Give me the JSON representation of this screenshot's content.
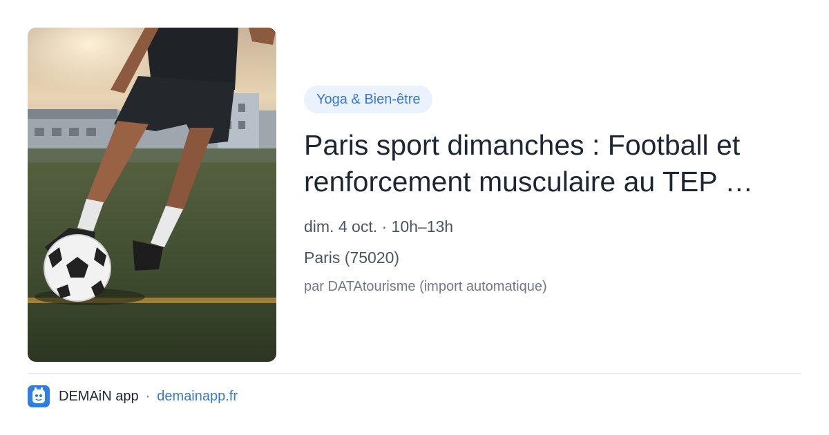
{
  "event": {
    "category_tag": "Yoga & Bien-être",
    "title": "Paris sport dimanches : Football et renforcement musculaire au TEP …",
    "date_time": "dim. 4 oct. · 10h–13h",
    "location": "Paris (75020)",
    "source": "par DATAtourisme (import automatique)",
    "image": "football-player-kicking-ball-photo"
  },
  "footer": {
    "logo": "demain-app-logo-icon",
    "app_name": "DEMAiN app",
    "separator": "·",
    "url": "demainapp.fr"
  },
  "colors": {
    "tag_background": "#eaf2fd",
    "tag_text": "#3a78cc",
    "title_text": "#1c2733",
    "meta_text": "#4a5562",
    "link": "#3a78cc",
    "logo_background": "#2f7fe0"
  }
}
